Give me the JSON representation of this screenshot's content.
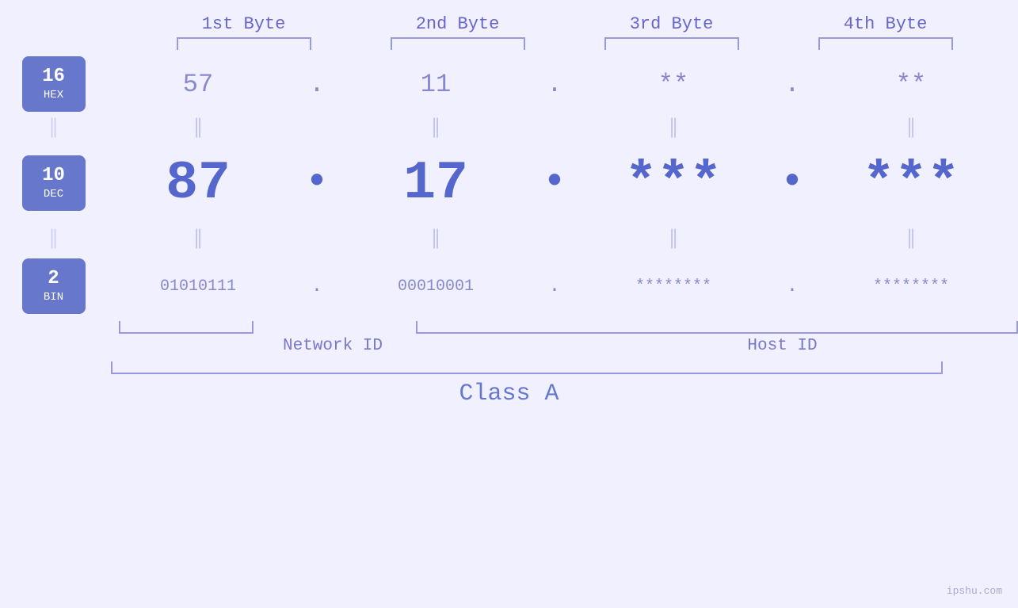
{
  "page": {
    "background": "#f0f0ff",
    "watermark": "ipshu.com"
  },
  "columns": [
    {
      "label": "1st Byte"
    },
    {
      "label": "2nd Byte"
    },
    {
      "label": "3rd Byte"
    },
    {
      "label": "4th Byte"
    }
  ],
  "bases": [
    {
      "number": "16",
      "label": "HEX"
    },
    {
      "number": "10",
      "label": "DEC"
    },
    {
      "number": "2",
      "label": "BIN"
    }
  ],
  "hex_values": [
    "57",
    "11",
    "**",
    "**"
  ],
  "dec_values": [
    "87",
    "17",
    "***",
    "***"
  ],
  "bin_values": [
    "01010111",
    "00010001",
    "********",
    "********"
  ],
  "separators": [
    ".",
    ".",
    ".",
    "."
  ],
  "network_id_label": "Network ID",
  "host_id_label": "Host ID",
  "class_label": "Class A"
}
